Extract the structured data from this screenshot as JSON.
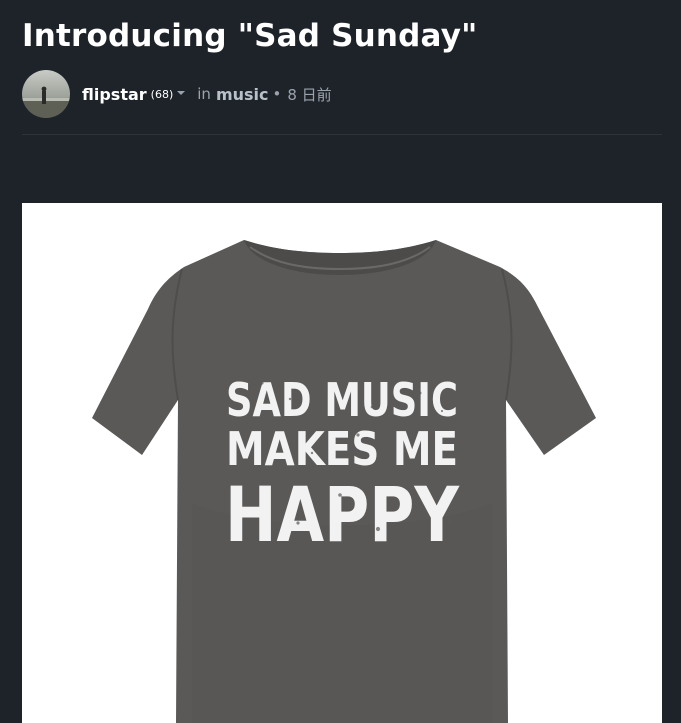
{
  "post": {
    "title": "Introducing \"Sad Sunday\"",
    "author": "flipstar",
    "reputation": "(68)",
    "in_label": "in",
    "community": "music",
    "separator": "•",
    "age": "8 日前"
  },
  "image": {
    "shirt_text": [
      "SAD MUSIC",
      "MAKES ME",
      "HAPPY"
    ]
  },
  "colors": {
    "background": "#1e2329",
    "title": "#ffffff",
    "meta": "#9aa3ad",
    "shirt": "#5a5957",
    "shirt_print": "#f2f2f2"
  },
  "icons": {
    "caret": "chevron-down-icon",
    "avatar": "avatar"
  }
}
